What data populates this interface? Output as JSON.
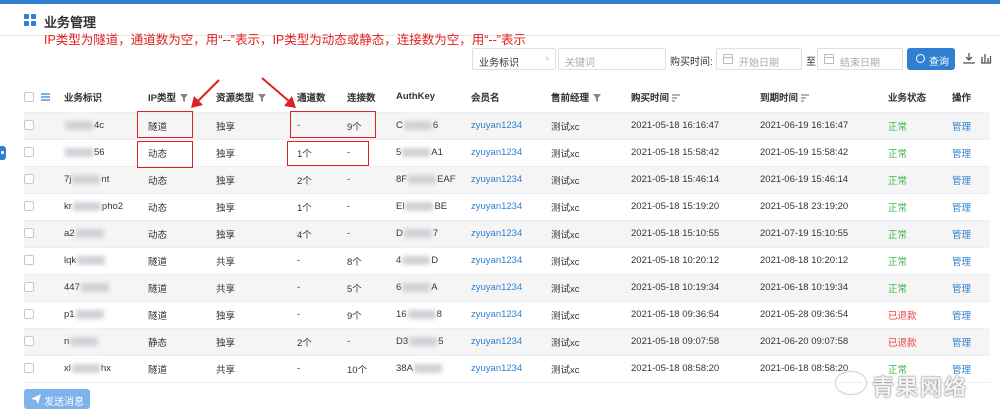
{
  "header": {
    "title": "业务管理"
  },
  "annotation": "IP类型为隧道，通道数为空，用“--”表示，IP类型为动态或静态，连接数为空，用“--”表示",
  "toolbar": {
    "select_value": "业务标识",
    "keyword_placeholder": "关键词",
    "buy_time_label": "购买时间:",
    "start_date_placeholder": "开始日期",
    "to_label": "至",
    "end_date_placeholder": "结束日期",
    "query_label": "查询"
  },
  "table": {
    "columns": [
      "业务标识",
      "IP类型",
      "资源类型",
      "通道数",
      "连接数",
      "AuthKey",
      "会员名",
      "售前经理",
      "购买时间",
      "到期时间",
      "业务状态",
      "操作"
    ],
    "rows": [
      {
        "id_prefix": "",
        "id_suffix": "4c",
        "ip_type": "隧道",
        "resource": "独享",
        "channels": "-",
        "connections": "9个",
        "auth_prefix": "C",
        "auth_suffix": "6",
        "member": "zyuyan1234",
        "manager": "测试xc",
        "buy_time": "2021-05-18 16:16:47",
        "expire_time": "2021-06-19 16:16:47",
        "status": "正常",
        "action": "管理"
      },
      {
        "id_prefix": "",
        "id_suffix": "56",
        "ip_type": "动态",
        "resource": "独享",
        "channels": "1个",
        "connections": "-",
        "auth_prefix": "5",
        "auth_suffix": "A1",
        "member": "zyuyan1234",
        "manager": "测试xc",
        "buy_time": "2021-05-18 15:58:42",
        "expire_time": "2021-05-19 15:58:42",
        "status": "正常",
        "action": "管理"
      },
      {
        "id_prefix": "7j",
        "id_suffix": "nt",
        "ip_type": "动态",
        "resource": "独享",
        "channels": "2个",
        "connections": "-",
        "auth_prefix": "8F",
        "auth_suffix": "EAF",
        "member": "zyuyan1234",
        "manager": "测试xc",
        "buy_time": "2021-05-18 15:46:14",
        "expire_time": "2021-06-19 15:46:14",
        "status": "正常",
        "action": "管理"
      },
      {
        "id_prefix": "kr",
        "id_suffix": "pho2",
        "ip_type": "动态",
        "resource": "独享",
        "channels": "1个",
        "connections": "-",
        "auth_prefix": "El",
        "auth_suffix": "BE",
        "member": "zyuyan1234",
        "manager": "测试xc",
        "buy_time": "2021-05-18 15:19:20",
        "expire_time": "2021-05-18 23:19:20",
        "status": "正常",
        "action": "管理"
      },
      {
        "id_prefix": "a2",
        "id_suffix": "",
        "ip_type": "动态",
        "resource": "独享",
        "channels": "4个",
        "connections": "-",
        "auth_prefix": "D",
        "auth_suffix": "7",
        "member": "zyuyan1234",
        "manager": "测试xc",
        "buy_time": "2021-05-18 15:10:55",
        "expire_time": "2021-07-19 15:10:55",
        "status": "正常",
        "action": "管理"
      },
      {
        "id_prefix": "lqk",
        "id_suffix": "",
        "ip_type": "隧道",
        "resource": "共享",
        "channels": "-",
        "connections": "8个",
        "auth_prefix": "4",
        "auth_suffix": "D",
        "member": "zyuyan1234",
        "manager": "测试xc",
        "buy_time": "2021-05-18 10:20:12",
        "expire_time": "2021-08-18 10:20:12",
        "status": "正常",
        "action": "管理"
      },
      {
        "id_prefix": "447",
        "id_suffix": "",
        "ip_type": "隧道",
        "resource": "共享",
        "channels": "-",
        "connections": "5个",
        "auth_prefix": "6",
        "auth_suffix": "A",
        "member": "zyuyan1234",
        "manager": "测试xc",
        "buy_time": "2021-05-18 10:19:34",
        "expire_time": "2021-06-18 10:19:34",
        "status": "正常",
        "action": "管理"
      },
      {
        "id_prefix": "p1",
        "id_suffix": "",
        "ip_type": "隧道",
        "resource": "独享",
        "channels": "-",
        "connections": "9个",
        "auth_prefix": "16",
        "auth_suffix": "8",
        "member": "zyuyan1234",
        "manager": "测试xc",
        "buy_time": "2021-05-18 09:36:54",
        "expire_time": "2021-05-28 09:36:54",
        "status": "已退款",
        "action": "管理"
      },
      {
        "id_prefix": "n",
        "id_suffix": "",
        "ip_type": "静态",
        "resource": "独享",
        "channels": "2个",
        "connections": "-",
        "auth_prefix": "D3",
        "auth_suffix": "5",
        "member": "zyuyan1234",
        "manager": "测试xc",
        "buy_time": "2021-05-18 09:07:58",
        "expire_time": "2021-06-20 09:07:58",
        "status": "已退款",
        "action": "管理"
      },
      {
        "id_prefix": "xl",
        "id_suffix": "hx",
        "ip_type": "隧道",
        "resource": "共享",
        "channels": "-",
        "connections": "10个",
        "auth_prefix": "38A",
        "auth_suffix": "",
        "member": "zyuyan1234",
        "manager": "测试xc",
        "buy_time": "2021-05-18 08:58:20",
        "expire_time": "2021-06-18 08:58:20",
        "status": "正常",
        "action": "管理"
      }
    ]
  },
  "footer": {
    "send_label": "发送消息"
  },
  "watermark": "青果网络",
  "colors": {
    "primary": "#2f80d1",
    "ok": "#3bb54a",
    "refund": "#e84040",
    "annotation": "#e02020"
  }
}
